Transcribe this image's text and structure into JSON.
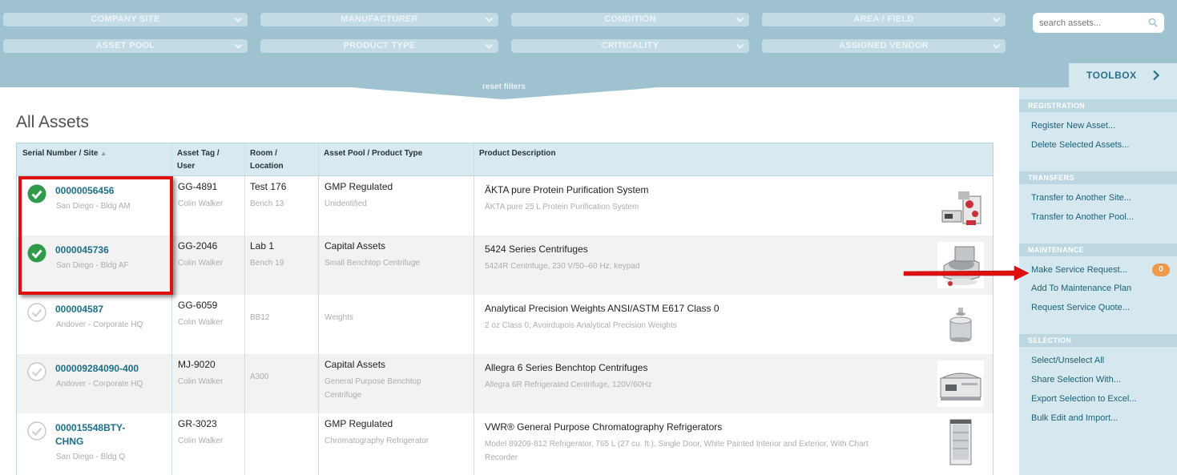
{
  "filters": {
    "company_site": "COMPANY SITE",
    "manufacturer": "MANUFACTURER",
    "condition": "CONDITION",
    "area_field": "AREA / FIELD",
    "asset_pool": "ASSET POOL",
    "product_type": "PRODUCT TYPE",
    "criticality": "CRITICALITY",
    "assigned_vendor": "ASSIGNED VENDOR",
    "reset": "reset filters"
  },
  "search": {
    "placeholder": "search assets..."
  },
  "page_title": "All Assets",
  "table": {
    "headers": {
      "serial": "Serial Number / Site",
      "sort_indicator": "▲",
      "asset_tag_1": "Asset Tag /",
      "asset_tag_2": "User",
      "room_1": "Room /",
      "room_2": "Location",
      "pool": "Asset Pool / Product Type",
      "description": "Product Description"
    },
    "rows": [
      {
        "serial": "00000056456",
        "site": "San Diego - Bldg AM",
        "checked": true,
        "tag": "GG-4891",
        "user": "Colin Walker",
        "room": "Test 176",
        "location": "Bench 13",
        "pool": "GMP Regulated",
        "product_type": "Unidentified",
        "description": "ÄKTA pure Protein Purification System",
        "description_sub": "ÄKTA pure 25 L Protein Purification System"
      },
      {
        "serial": "0000045736",
        "site": "San Diego - Bldg AF",
        "checked": true,
        "tag": "GG-2046",
        "user": "Colin Walker",
        "room": "Lab 1",
        "location": "Bench 19",
        "pool": "Capital Assets",
        "product_type": "Small Benchtop Centrifuge",
        "description": "5424 Series Centrifuges",
        "description_sub": "5424R Centrifuge, 230 V/50–60 Hz, keypad"
      },
      {
        "serial": "000004587",
        "site": "Andover - Corporate HQ",
        "checked": false,
        "tag": "GG-6059",
        "user": "Colin Walker",
        "room": "",
        "location": "BB12",
        "pool": "",
        "product_type": "Weights",
        "description": "Analytical Precision Weights ANSI/ASTM E617 Class 0",
        "description_sub": "2 oz Class 0, Avoirdupois Analytical Precision Weights"
      },
      {
        "serial": "000009284090-400",
        "site": "Andover - Corporate HQ",
        "checked": false,
        "tag": "MJ-9020",
        "user": "Colin Walker",
        "room": "",
        "location": "A300",
        "pool": "Capital Assets",
        "product_type_1": "General Purpose Benchtop",
        "product_type_2": "Centrifuge",
        "description": "Allegra 6 Series Benchtop Centrifuges",
        "description_sub": "Allegra 6R Refrigerated Centrifuge, 120V/60Hz"
      },
      {
        "serial_1": "000015548BTY-",
        "serial_2": "CHNG",
        "site": "San Diego - Bldg Q",
        "checked": false,
        "tag": "GR-3023",
        "user": "Colin Walker",
        "room": "",
        "location": "",
        "pool": "GMP Regulated",
        "product_type": "Chromatography Refrigerator",
        "description": "VWR® General Purpose Chromatography Refrigerators",
        "description_sub_1": "Model 89209-812 Refrigerator, 765 L (27 cu. ft.), Single Door, White Painted Interior and Exterior, With Chart",
        "description_sub_2": "Recorder"
      }
    ]
  },
  "toolbox": {
    "title": "TOOLBOX",
    "registration": {
      "heading": "REGISTRATION",
      "items": [
        "Register New Asset...",
        "Delete Selected Assets..."
      ]
    },
    "transfers": {
      "heading": "TRANSFERS",
      "items": [
        "Transfer to Another Site...",
        "Transfer to Another Pool..."
      ]
    },
    "maintenance": {
      "heading": "MAINTENANCE",
      "items": [
        "Make Service Request...",
        "Add To Maintenance Plan",
        "Request Service Quote..."
      ],
      "badge": "0"
    },
    "selection": {
      "heading": "SELECTION",
      "items": [
        "Select/Unselect All",
        "Share Selection With...",
        "Export Selection to Excel...",
        "Bulk Edit and Import..."
      ]
    }
  },
  "colors": {
    "header_blue": "#9ec2d0",
    "panel_blue": "#d6e8ef",
    "link": "#1b5f77",
    "check_green": "#2e9b4a",
    "annotation_red": "#e01010",
    "badge_orange": "#f0994a"
  }
}
